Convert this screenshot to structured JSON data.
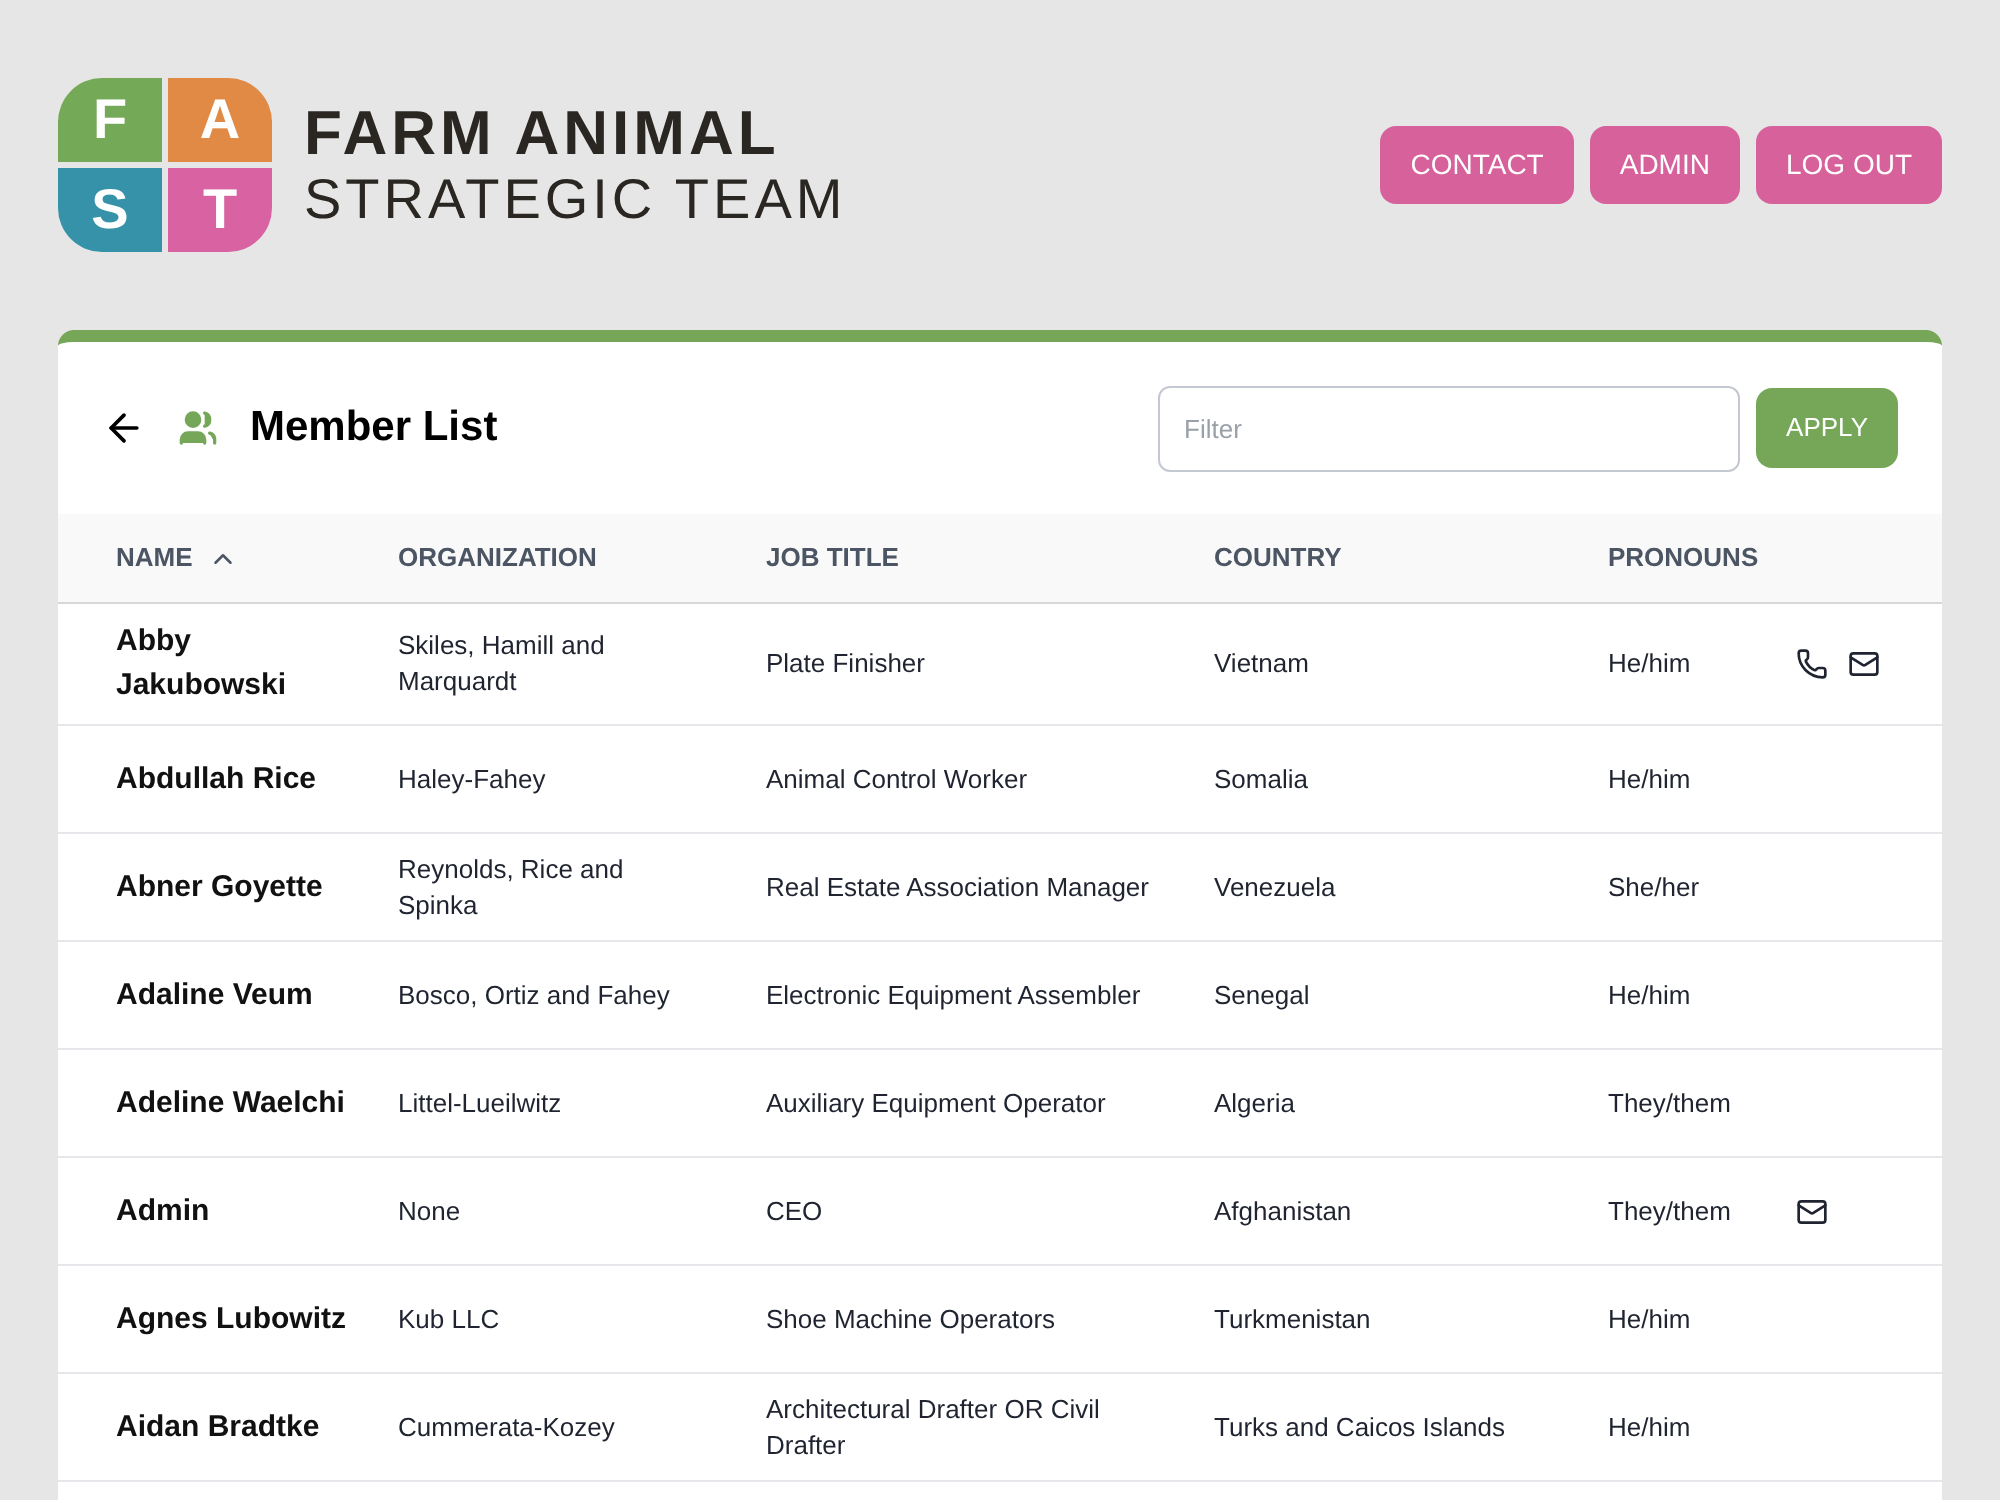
{
  "logo": {
    "tiles": [
      {
        "letter": "F",
        "color": "#74a957"
      },
      {
        "letter": "A",
        "color": "#e08a45"
      },
      {
        "letter": "S",
        "color": "#3592a8"
      },
      {
        "letter": "T",
        "color": "#d862a2"
      }
    ],
    "title": "FARM ANIMAL",
    "subtitle": "STRATEGIC TEAM"
  },
  "nav_buttons": [
    "CONTACT",
    "ADMIN",
    "LOG OUT"
  ],
  "panel": {
    "title": "Member List",
    "filter": {
      "placeholder": "Filter"
    },
    "apply_button": "APPLY"
  },
  "table": {
    "columns": [
      {
        "label": "NAME",
        "sorted": true
      },
      {
        "label": "ORGANIZATION",
        "sorted": false
      },
      {
        "label": "JOB TITLE",
        "sorted": false
      },
      {
        "label": "COUNTRY",
        "sorted": false
      },
      {
        "label": "PRONOUNS",
        "sorted": false
      }
    ],
    "rows": [
      {
        "name": "Abby Jakubowski",
        "organization": "Skiles, Hamill and Marquardt",
        "job_title": "Plate Finisher",
        "country": "Vietnam",
        "pronouns": "He/him",
        "phone": true,
        "email": true
      },
      {
        "name": "Abdullah Rice",
        "organization": "Haley-Fahey",
        "job_title": "Animal Control Worker",
        "country": "Somalia",
        "pronouns": "He/him",
        "phone": false,
        "email": false
      },
      {
        "name": "Abner Goyette",
        "organization": "Reynolds, Rice and Spinka",
        "job_title": "Real Estate Association Manager",
        "country": "Venezuela",
        "pronouns": "She/her",
        "phone": false,
        "email": false
      },
      {
        "name": "Adaline Veum",
        "organization": "Bosco, Ortiz and Fahey",
        "job_title": "Electronic Equipment Assembler",
        "country": "Senegal",
        "pronouns": "He/him",
        "phone": false,
        "email": false
      },
      {
        "name": "Adeline Waelchi",
        "organization": "Littel-Lueilwitz",
        "job_title": "Auxiliary Equipment Operator",
        "country": "Algeria",
        "pronouns": "They/them",
        "phone": false,
        "email": false
      },
      {
        "name": "Admin",
        "organization": "None",
        "job_title": "CEO",
        "country": "Afghanistan",
        "pronouns": "They/them",
        "phone": false,
        "email": true
      },
      {
        "name": "Agnes Lubowitz",
        "organization": "Kub LLC",
        "job_title": "Shoe Machine Operators",
        "country": "Turkmenistan",
        "pronouns": "He/him",
        "phone": false,
        "email": false
      },
      {
        "name": "Aidan Bradtke",
        "organization": "Cummerata-Kozey",
        "job_title": "Architectural Drafter OR Civil Drafter",
        "country": "Turks and Caicos Islands",
        "pronouns": "He/him",
        "phone": false,
        "email": false
      }
    ]
  }
}
